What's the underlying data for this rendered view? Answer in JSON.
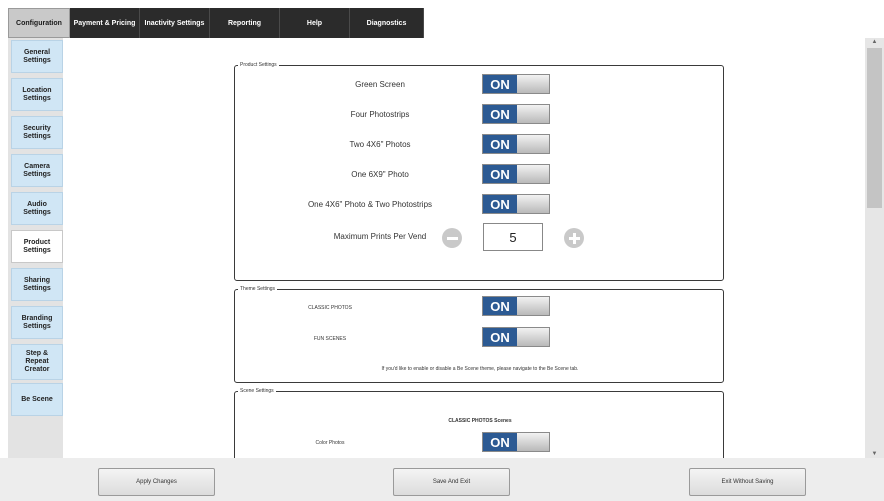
{
  "top_tabs": [
    {
      "label": "Configuration",
      "active": true
    },
    {
      "label": "Payment & Pricing"
    },
    {
      "label": "Inactivity Settings"
    },
    {
      "label": "Reporting"
    },
    {
      "label": "Help"
    },
    {
      "label": "Diagnostics"
    }
  ],
  "sidebar": {
    "items": [
      {
        "label": "General\nSettings"
      },
      {
        "label": "Location\nSettings"
      },
      {
        "label": "Security\nSettings"
      },
      {
        "label": "Camera\nSettings"
      },
      {
        "label": "Audio\nSettings"
      },
      {
        "label": "Product\nSettings",
        "active": true
      },
      {
        "label": "Sharing\nSettings"
      },
      {
        "label": "Branding\nSettings"
      },
      {
        "label": "Step &\nRepeat\nCreator"
      },
      {
        "label": "Be Scene"
      }
    ]
  },
  "product_settings": {
    "legend": "Product Settings",
    "rows": [
      {
        "label": "Green Screen",
        "toggle": "ON"
      },
      {
        "label": "Four Photostrips",
        "toggle": "ON"
      },
      {
        "label": "Two 4X6\" Photos",
        "toggle": "ON"
      },
      {
        "label": "One 6X9\" Photo",
        "toggle": "ON"
      },
      {
        "label": "One 4X6\" Photo & Two Photostrips",
        "toggle": "ON"
      }
    ],
    "max_prints_label": "Maximum Prints Per Vend",
    "max_prints_value": "5"
  },
  "theme_settings": {
    "legend": "Theme Settings",
    "rows": [
      {
        "label": "CLASSIC PHOTOS",
        "toggle": "ON"
      },
      {
        "label": "FUN SCENES",
        "toggle": "ON"
      }
    ],
    "note": "If you'd like to enable or disable a Be Scene theme, please navigate to the Be Scene tab."
  },
  "scene_settings": {
    "legend": "Scene Settings",
    "heading": "CLASSIC PHOTOS Scenes",
    "rows": [
      {
        "label": "Color Photos",
        "toggle": "ON"
      }
    ]
  },
  "bottom_buttons": {
    "apply": "Apply Changes",
    "save_exit": "Save And Exit",
    "exit_no_save": "Exit Without Saving"
  },
  "colors": {
    "toggle_on": "#2c5a93",
    "sidebar_item": "#d0e6f5",
    "tab_bg": "#2b2b2b"
  }
}
